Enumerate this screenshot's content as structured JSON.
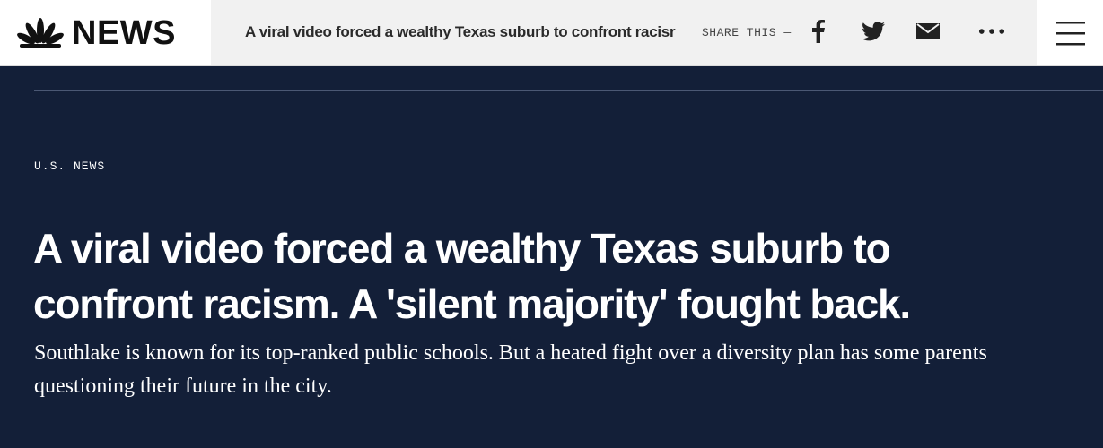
{
  "header": {
    "logo_text": "NEWS",
    "logo_icon": "peacock-icon",
    "headline": "A viral video forced a wealthy Texas suburb to confront racisr",
    "share_label": "SHARE THIS —",
    "share_icons": [
      "facebook-icon",
      "twitter-icon",
      "email-icon",
      "more-icon"
    ],
    "menu_icon": "hamburger-menu-icon"
  },
  "article": {
    "category": "U.S. NEWS",
    "title": "A viral video forced a wealthy Texas suburb to confront racism. A 'silent majority' fought back.",
    "dek": "Southlake is known for its top-ranked public schools. But a heated fight over a diversity plan has some parents questioning their future in the city."
  },
  "colors": {
    "hero_background": "#131f38",
    "share_strip_background": "#f1f1f1",
    "divider": "#4b5874"
  }
}
